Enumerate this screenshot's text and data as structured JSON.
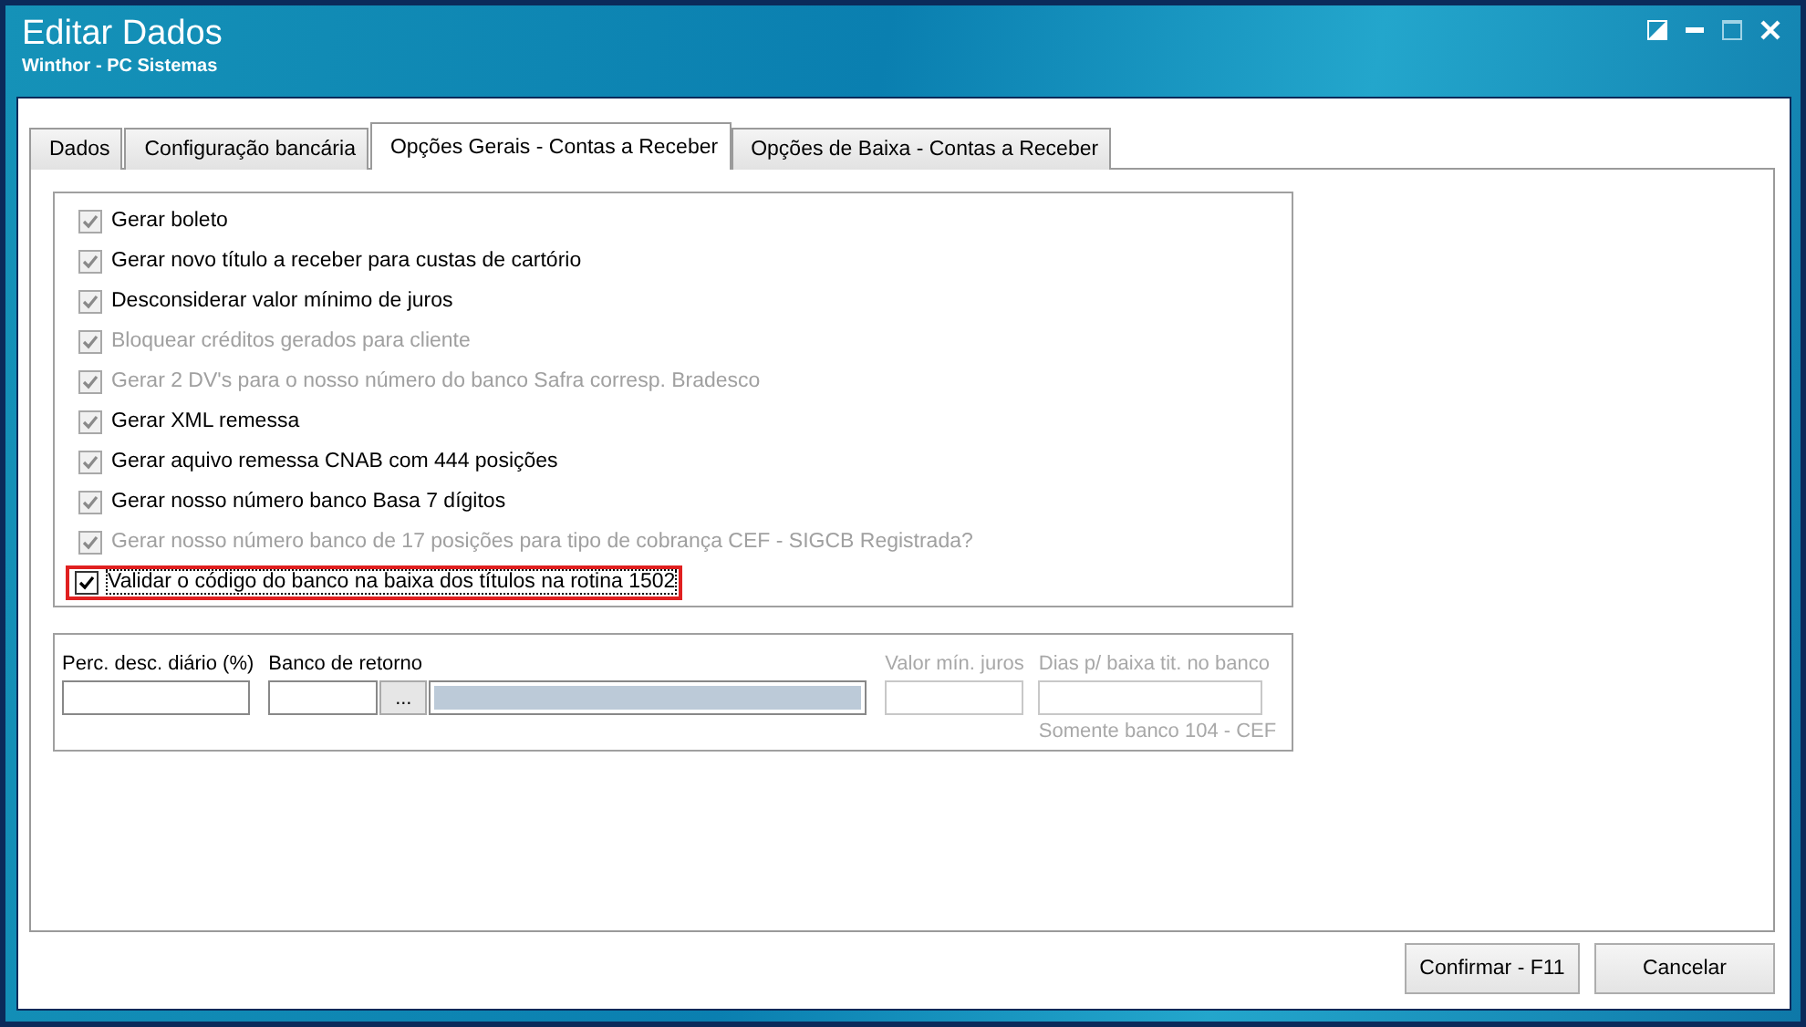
{
  "window": {
    "title": "Editar Dados",
    "subtitle": "Winthor - PC Sistemas"
  },
  "tabs": [
    {
      "label": "Dados",
      "selected": false
    },
    {
      "label": "Configuração bancária",
      "selected": false
    },
    {
      "label": "Opções Gerais - Contas a Receber",
      "selected": true
    },
    {
      "label": "Opções de Baixa - Contas a Receber",
      "selected": false
    }
  ],
  "options": [
    {
      "label": "Gerar boleto",
      "checked": true,
      "locked": true,
      "disabled": false,
      "highlighted": false
    },
    {
      "label": "Gerar novo título a receber para custas de cartório",
      "checked": true,
      "locked": true,
      "disabled": false,
      "highlighted": false
    },
    {
      "label": "Desconsiderar valor mínimo de juros",
      "checked": true,
      "locked": true,
      "disabled": false,
      "highlighted": false
    },
    {
      "label": "Bloquear créditos gerados para cliente",
      "checked": true,
      "locked": true,
      "disabled": true,
      "highlighted": false
    },
    {
      "label": "Gerar 2 DV's para o nosso número do banco Safra corresp. Bradesco",
      "checked": true,
      "locked": true,
      "disabled": true,
      "highlighted": false
    },
    {
      "label": "Gerar XML remessa",
      "checked": true,
      "locked": true,
      "disabled": false,
      "highlighted": false
    },
    {
      "label": "Gerar aquivo remessa CNAB com 444 posições",
      "checked": true,
      "locked": true,
      "disabled": false,
      "highlighted": false
    },
    {
      "label": "Gerar nosso número banco Basa 7 dígitos",
      "checked": true,
      "locked": true,
      "disabled": false,
      "highlighted": false
    },
    {
      "label": "Gerar nosso número banco de 17 posições para tipo de cobrança CEF - SIGCB Registrada?",
      "checked": true,
      "locked": true,
      "disabled": true,
      "highlighted": false
    },
    {
      "label": "Validar o código do banco na baixa dos títulos na rotina 1502",
      "checked": true,
      "locked": false,
      "disabled": false,
      "highlighted": true
    }
  ],
  "fields": {
    "perc": {
      "label": "Perc. desc. diário (%)",
      "disabled": false
    },
    "banco": {
      "label": "Banco de retorno",
      "disabled": false,
      "lookup_button": "...",
      "description_disabled": true
    },
    "valor": {
      "label": "Valor mín. juros",
      "disabled": true
    },
    "dias": {
      "label": "Dias p/ baixa tit. no banco",
      "disabled": true,
      "note": "Somente banco 104 - CEF"
    }
  },
  "buttons": [
    {
      "label": "Confirmar - F11"
    },
    {
      "label": "Cancelar"
    }
  ]
}
